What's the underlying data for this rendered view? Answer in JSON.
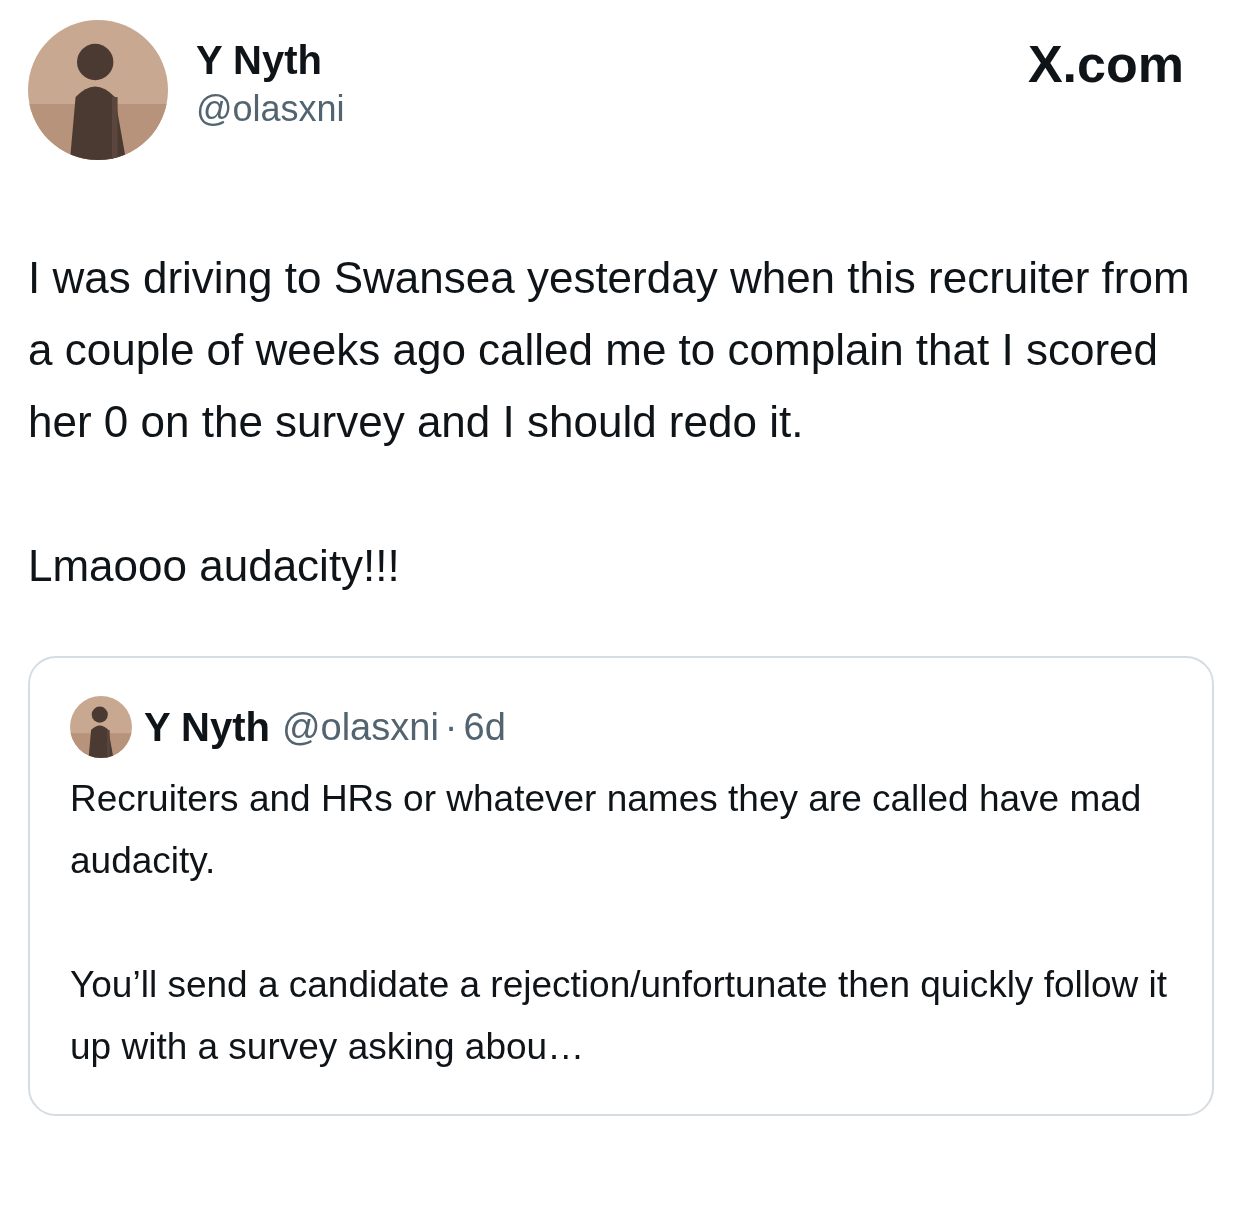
{
  "author": {
    "name": "Y Nyth",
    "handle": "@olasxni"
  },
  "brand": "X.com",
  "tweet": {
    "paragraphs": [
      "I was driving to Swansea yesterday when this recruiter from a couple of weeks ago called me to complain that I scored her 0 on the survey and I should redo it.",
      "Lmaooo audacity!!!"
    ]
  },
  "quoted_tweet": {
    "name": "Y Nyth",
    "handle": "@olasxni",
    "separator": "·",
    "time": "6d",
    "paragraphs": [
      "Recruiters and HRs or whatever names they are called have mad audacity.",
      "You’ll send a candidate a rejection/unfortunate then quickly follow it up with a survey asking abou…"
    ]
  }
}
